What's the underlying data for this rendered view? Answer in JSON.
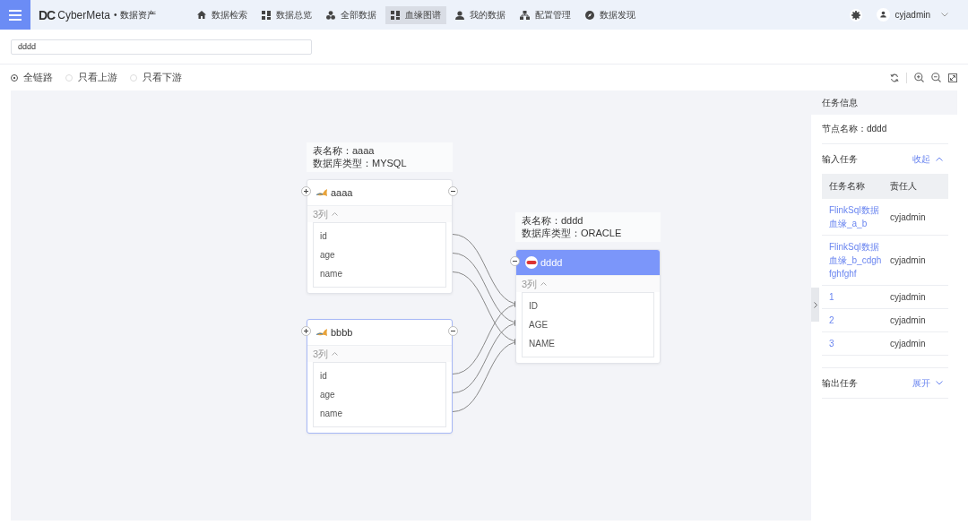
{
  "header": {
    "logo_mark": "DC",
    "brand": "CyberMeta",
    "separator": "•",
    "product": "数据资产",
    "nav": [
      {
        "label": "数据检索",
        "selected": false
      },
      {
        "label": "数据总览",
        "selected": false
      },
      {
        "label": "全部数据",
        "selected": false
      },
      {
        "label": "血缘图谱",
        "selected": true
      },
      {
        "label": "我的数据",
        "selected": false
      },
      {
        "label": "配置管理",
        "selected": false
      },
      {
        "label": "数据发现",
        "selected": false
      }
    ],
    "user": "cyjadmin"
  },
  "search": {
    "value": "dddd"
  },
  "scope": [
    {
      "label": "全链路",
      "selected": true
    },
    {
      "label": "只看上游",
      "selected": false
    },
    {
      "label": "只看下游",
      "selected": false
    }
  ],
  "graph": {
    "nodes": [
      {
        "kind": "source",
        "name": "aaaa",
        "selected": false,
        "highlighted": false,
        "info": [
          "表名称：aaaa",
          "数据库类型：MYSQL"
        ],
        "count": "3列",
        "fields": [
          "id",
          "age",
          "name"
        ]
      },
      {
        "kind": "source",
        "name": "bbbb",
        "selected": false,
        "highlighted": true,
        "count": "3列",
        "fields": [
          "id",
          "age",
          "name"
        ]
      },
      {
        "kind": "target",
        "name": "dddd",
        "selected": true,
        "highlighted": false,
        "info": [
          "表名称：dddd",
          "数据库类型：ORACLE"
        ],
        "count": "3列",
        "fields": [
          "ID",
          "AGE",
          "NAME"
        ]
      }
    ]
  },
  "panel": {
    "title": "任务信息",
    "node_line": "节点名称：dddd",
    "sections": [
      {
        "title": "输入任务",
        "toggle": "收起",
        "expanded": true,
        "columns": [
          "任务名称",
          "责任人"
        ],
        "rows": [
          {
            "task": "FlinkSql数据血缘_a_b",
            "owner": "cyjadmin"
          },
          {
            "task": "FlinkSql数据血缘_b_cdghfghfghf",
            "owner": "cyjadmin"
          },
          {
            "task": "1",
            "owner": "cyjadmin"
          },
          {
            "task": "2",
            "owner": "cyjadmin"
          },
          {
            "task": "3",
            "owner": "cyjadmin"
          }
        ]
      },
      {
        "title": "输出任务",
        "toggle": "展开",
        "expanded": false
      }
    ]
  }
}
